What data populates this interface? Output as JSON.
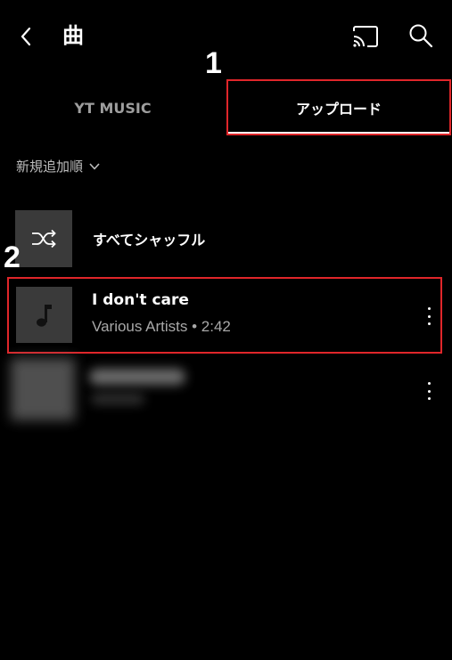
{
  "header": {
    "title": "曲",
    "back_icon": "chevron-left-icon",
    "cast_icon": "cast-icon",
    "search_icon": "search-icon"
  },
  "tabs": [
    {
      "label": "YT MUSIC",
      "selected": false
    },
    {
      "label": "アップロード",
      "selected": true
    }
  ],
  "sort": {
    "label": "新規追加順",
    "icon": "chevron-down-icon"
  },
  "shuffle": {
    "label": "すべてシャッフル",
    "icon": "shuffle-icon"
  },
  "songs": [
    {
      "title": "I don't care",
      "subtitle": "Various Artists • 2:42",
      "thumb_icon": "music-note-icon"
    }
  ],
  "annotations": {
    "marker1": "1",
    "marker2": "2",
    "color": "#e0262a"
  }
}
